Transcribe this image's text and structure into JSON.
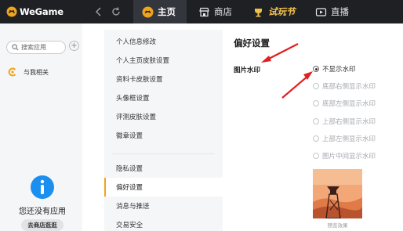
{
  "app": {
    "name": "WeGame"
  },
  "nav": {
    "tabs": [
      {
        "label": "主页",
        "icon": "home-icon",
        "active": true
      },
      {
        "label": "商店",
        "icon": "store-icon",
        "active": false
      },
      {
        "label": "试玩节",
        "icon": "trial-festival-icon",
        "active": false
      },
      {
        "label": "直播",
        "icon": "live-icon",
        "active": false
      }
    ]
  },
  "sidebar": {
    "search_placeholder": "搜索应用",
    "related_label": "与我相关",
    "empty_text": "您还没有应用",
    "store_button": "去商店逛逛"
  },
  "menu": {
    "items": [
      {
        "label": "个人信息修改",
        "active": false
      },
      {
        "label": "个人主页皮肤设置",
        "active": false
      },
      {
        "label": "资料卡皮肤设置",
        "active": false
      },
      {
        "label": "头像框设置",
        "active": false
      },
      {
        "label": "评测皮肤设置",
        "active": false
      },
      {
        "label": "徽章设置",
        "active": false
      },
      {
        "label": "隐私设置",
        "active": false
      },
      {
        "label": "偏好设置",
        "active": true
      },
      {
        "label": "消息与推送",
        "active": false
      },
      {
        "label": "交易安全",
        "active": false
      }
    ]
  },
  "main": {
    "title": "偏好设置",
    "field_label": "图片水印",
    "options": [
      {
        "label": "不显示水印",
        "selected": true
      },
      {
        "label": "底部右侧显示水印",
        "selected": false
      },
      {
        "label": "底部左侧显示水印",
        "selected": false
      },
      {
        "label": "上部右侧显示水印",
        "selected": false
      },
      {
        "label": "上部左侧显示水印",
        "selected": false
      },
      {
        "label": "图片中间显示水印",
        "selected": false
      }
    ],
    "preview_caption": "预览效果"
  },
  "colors": {
    "topbar": "#1e2024",
    "accent": "#f0a31c",
    "annotation_arrow": "#e02020",
    "sale_text": "#f0c04a"
  }
}
